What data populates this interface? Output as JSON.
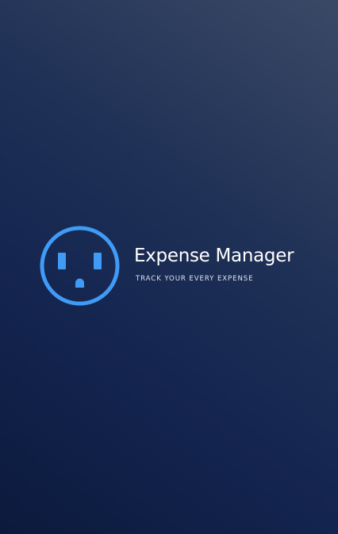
{
  "app": {
    "title": "Expense Manager",
    "tagline": "TRACK YOUR EVERY EXPENSE"
  },
  "icons": {
    "logo": "outlet-face-icon"
  },
  "colors": {
    "accent": "#3f9bf6",
    "title_text": "#ffffff",
    "tagline_text": "#dfe5f0",
    "background_dark": "#0b1a3c",
    "background_light": "#3b4966"
  }
}
